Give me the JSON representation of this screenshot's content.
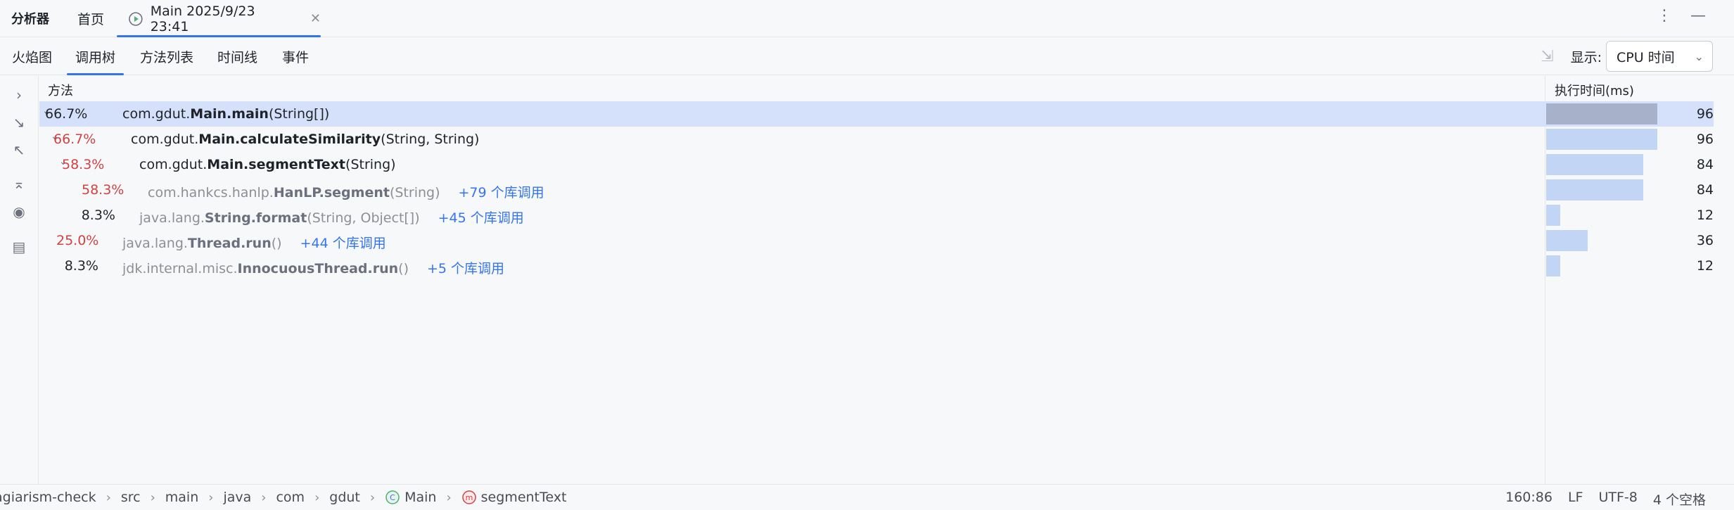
{
  "app_title": "分析器",
  "top_tabs": {
    "home": "首页",
    "main": "Main 2025/9/23 23:41"
  },
  "top_actions": {
    "more": "⋮",
    "minimize": "—"
  },
  "view_tabs": [
    "火焰图",
    "调用树",
    "方法列表",
    "时间线",
    "事件"
  ],
  "active_view": "调用树",
  "display": {
    "label": "显示:",
    "selected": "CPU 时间"
  },
  "table": {
    "col_method": "方法",
    "col_time": "执行时间(ms)",
    "max_value": 96,
    "rows": [
      {
        "pct": "66.7%",
        "pkg": "com.gdut.",
        "cls": "Main.main",
        "args": "(String[])",
        "lib": "",
        "value": 96,
        "expanded": true,
        "depth": 0,
        "pct_color": "dark",
        "dim": false,
        "selected": true
      },
      {
        "pct": "66.7%",
        "pkg": "com.gdut.",
        "cls": "Main.calculateSimilarity",
        "args": "(String, String)",
        "lib": "",
        "value": 96,
        "expanded": true,
        "depth": 1,
        "pct_color": "red",
        "dim": false,
        "selected": false
      },
      {
        "pct": "58.3%",
        "pkg": "com.gdut.",
        "cls": "Main.segmentText",
        "args": "(String)",
        "lib": "",
        "value": 84,
        "expanded": true,
        "depth": 2,
        "pct_color": "red",
        "dim": false,
        "selected": false
      },
      {
        "pct": "58.3%",
        "pkg": "com.hankcs.hanlp.",
        "cls": "HanLP.segment",
        "args": "(String)",
        "lib": "+79 个库调用",
        "value": 84,
        "expanded": false,
        "depth": 3,
        "pct_color": "red",
        "dim": true,
        "selected": false
      },
      {
        "pct": "8.3%",
        "pkg": "java.lang.",
        "cls": "String.format",
        "args": "(String, Object[])",
        "lib": "+45 个库调用",
        "value": 12,
        "expanded": false,
        "depth": 2,
        "pct_color": "dark",
        "dim": true,
        "selected": false
      },
      {
        "pct": "25.0%",
        "pkg": "java.lang.",
        "cls": "Thread.run",
        "args": "()",
        "lib": "+44 个库调用",
        "value": 36,
        "expanded": false,
        "depth": 0,
        "pct_color": "red",
        "dim": true,
        "selected": false
      },
      {
        "pct": "8.3%",
        "pkg": "jdk.internal.misc.",
        "cls": "InnocuousThread.run",
        "args": "()",
        "lib": "+5 个库调用",
        "value": 12,
        "expanded": false,
        "depth": 0,
        "pct_color": "dark",
        "dim": true,
        "selected": false
      }
    ]
  },
  "breadcrumb": [
    "agiarism-check",
    "src",
    "main",
    "java",
    "com",
    "gdut",
    "Main",
    "segmentText"
  ],
  "status": {
    "position": "160:86",
    "line_ending": "LF",
    "encoding": "UTF-8",
    "indent": "4 个空格"
  },
  "colors": {
    "accent": "#3574f0",
    "hot": "#d14242",
    "bar": "#c2d5f5",
    "bar_selected": "#a7b1c9",
    "selected_row": "#d5e1fb"
  }
}
